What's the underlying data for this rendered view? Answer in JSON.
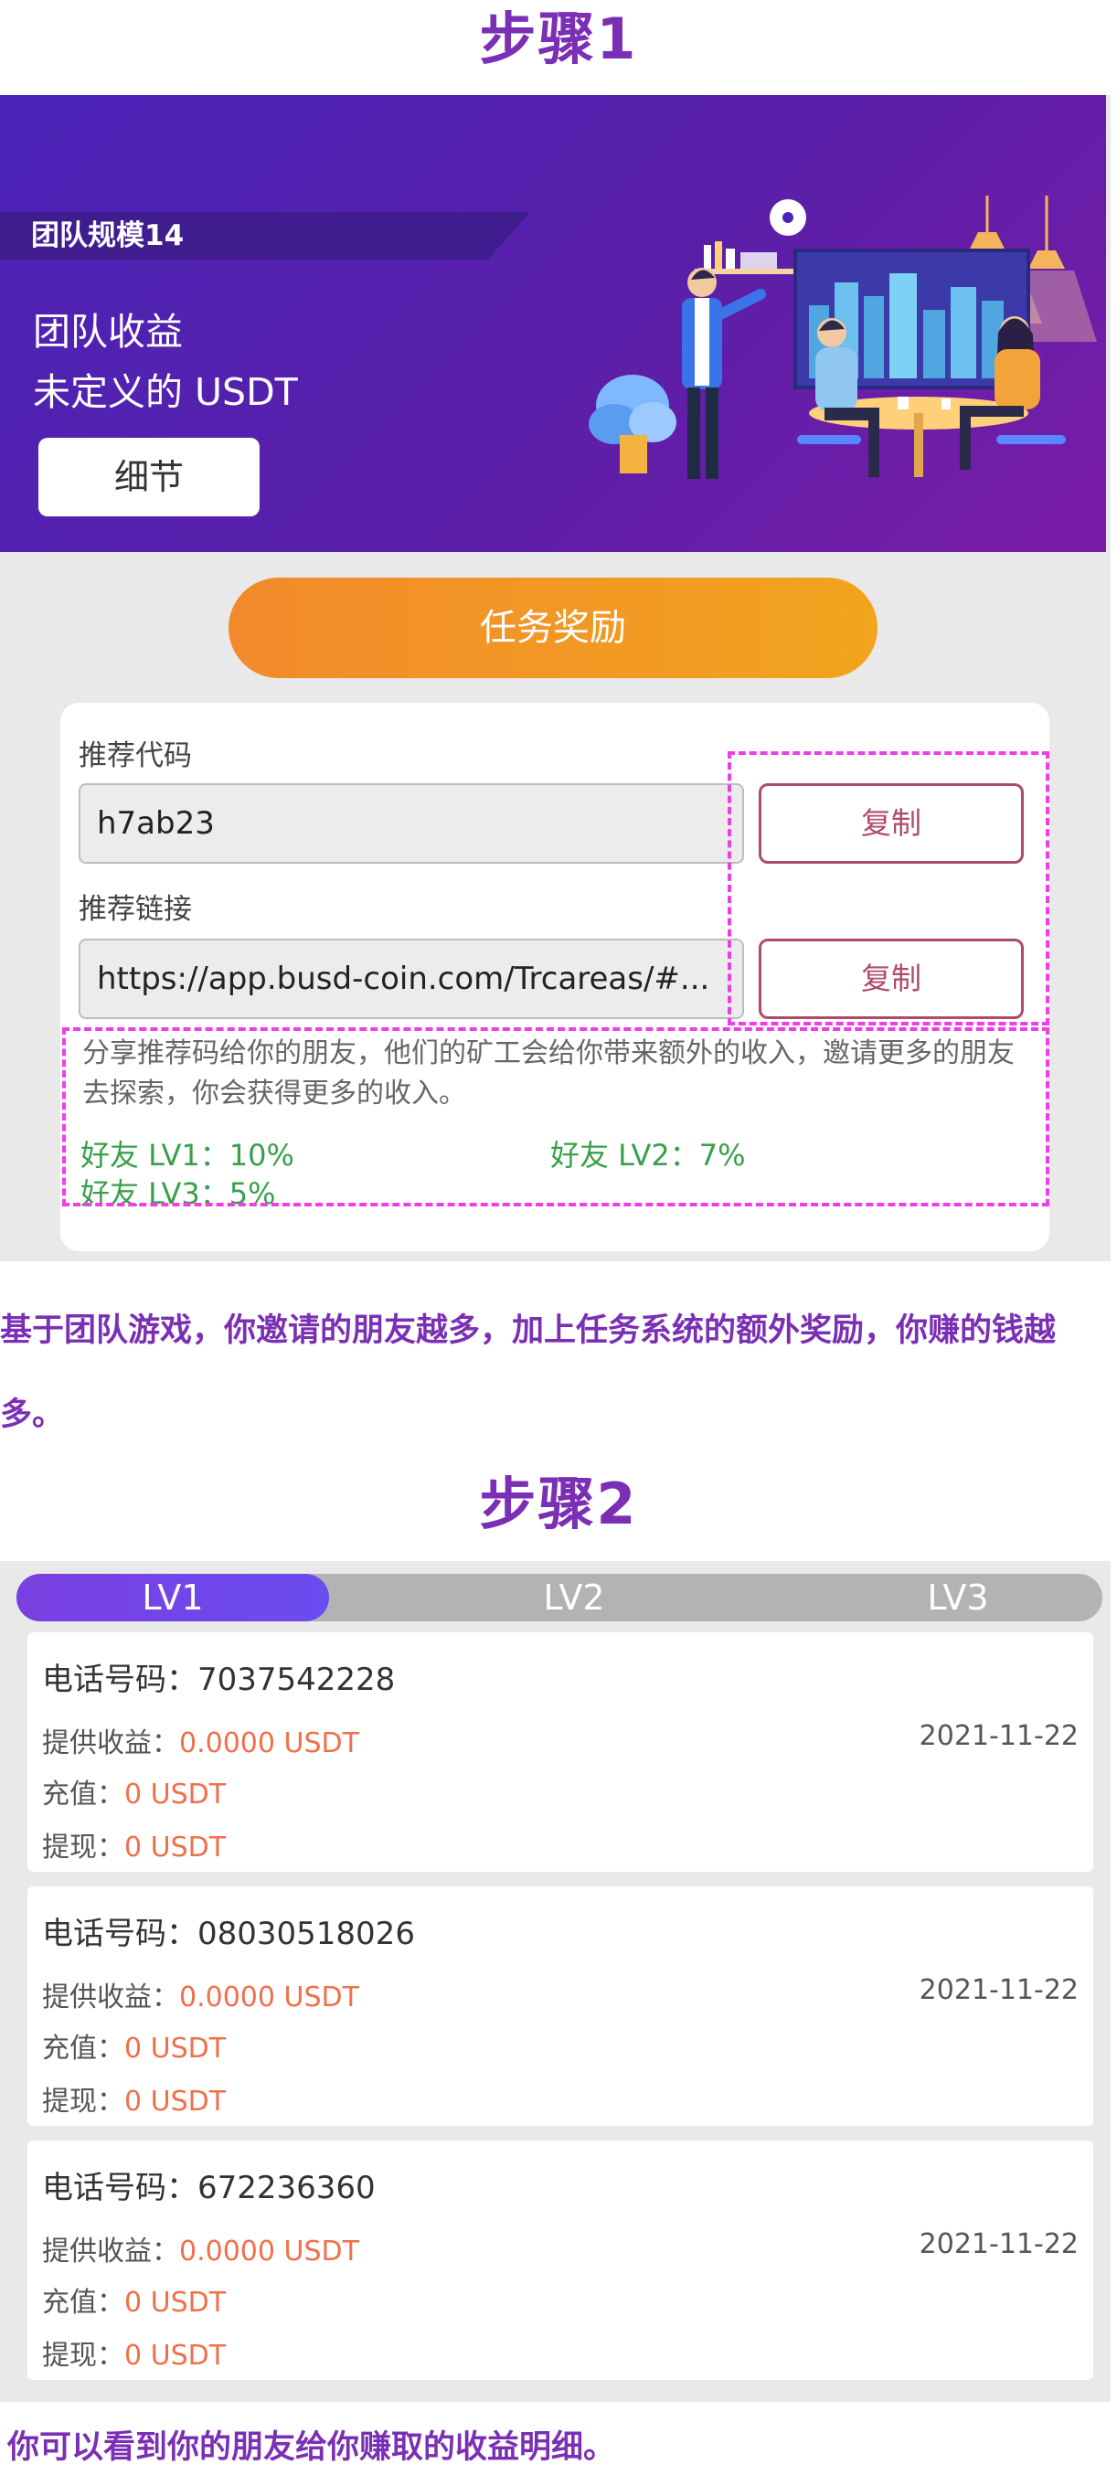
{
  "step1": {
    "title": "步骤1",
    "team_scale": "团队规模14",
    "team_income_label": "团队收益",
    "team_income_value": "未定义的 USDT",
    "detail_button": "细节",
    "task_reward_button": "任务奖励",
    "referral_code_label": "推荐代码",
    "referral_code_value": "h7ab23",
    "referral_link_label": "推荐链接",
    "referral_link_value": "https://app.busd-coin.com/Trcareas/#...",
    "copy_button": "复制",
    "share_text": "分享推荐码给你的朋友，他们的矿工会给你带来额外的收入，邀请更多的朋友去探索，你会获得更多的收入。",
    "levels": {
      "lv1": "好友 LV1：10%",
      "lv2": "好友 LV2：7%",
      "lv3": "好友 LV3：5%"
    },
    "caption": "基于团队游戏，你邀请的朋友越多，加上任务系统的额外奖励，你赚的钱越多。"
  },
  "step2": {
    "title": "步骤2",
    "tabs": [
      "LV1",
      "LV2",
      "LV3"
    ],
    "active_tab": "LV1",
    "labels": {
      "phone": "电话号码：",
      "income": "提供收益：",
      "recharge": "充值：",
      "withdraw": "提现："
    },
    "records": [
      {
        "phone": "7037542228",
        "income": "0.0000 USDT",
        "recharge": "0 USDT",
        "withdraw": "0 USDT",
        "date": "2021-11-22"
      },
      {
        "phone": "08030518026",
        "income": "0.0000 USDT",
        "recharge": "0 USDT",
        "withdraw": "0 USDT",
        "date": "2021-11-22"
      },
      {
        "phone": "672236360",
        "income": "0.0000 USDT",
        "recharge": "0 USDT",
        "withdraw": "0 USDT",
        "date": "2021-11-22"
      }
    ],
    "caption": "你可以看到你的朋友给你赚取的收益明细。"
  },
  "colors": {
    "title_purple": "#7b2fb5",
    "banner_purple": "#5a1fa8",
    "task_orange": "#f2a41e",
    "copy_border": "#b04a6a",
    "dash_magenta": "#ef3de8",
    "level_green": "#38a04a",
    "amount_orange": "#f0704a",
    "tab_active": "#7a3fe0"
  }
}
